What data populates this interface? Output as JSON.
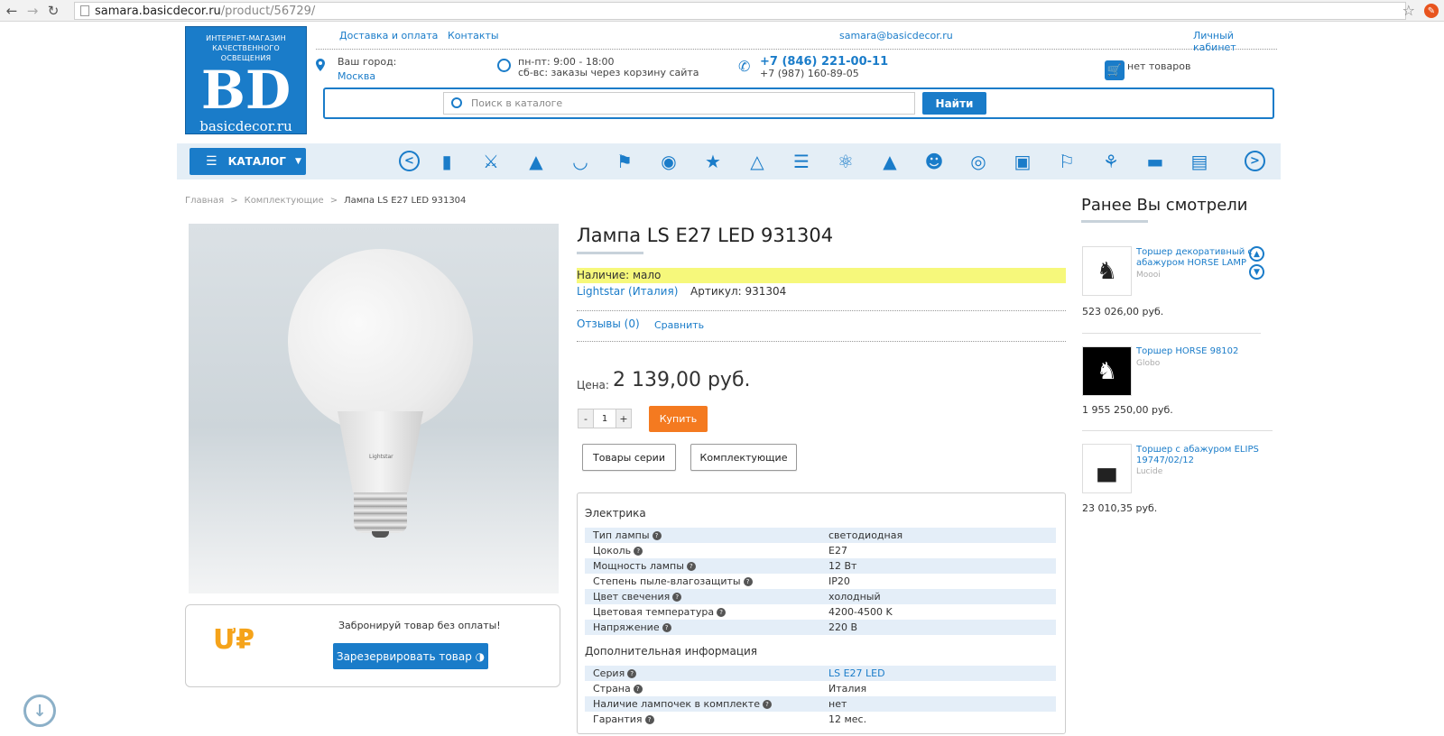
{
  "browser": {
    "url_host": "samara.basicdecor.ru",
    "url_path": "/product/56729/"
  },
  "header": {
    "logo": {
      "tagline_line1": "ИНТЕРНЕТ-МАГАЗИН",
      "tagline_line2": "КАЧЕСТВЕННОГО ОСВЕЩЕНИЯ",
      "mark": "BD",
      "site": "basicdecor.ru"
    },
    "links": {
      "delivery": "Доставка и оплата",
      "contacts": "Контакты",
      "email": "samara@basicdecor.ru",
      "account": "Личный кабинет"
    },
    "city": {
      "label": "Ваш город:",
      "value": "Москва"
    },
    "hours": {
      "line1": "пн-пт: 9:00 - 18:00",
      "line2": "сб-вс: заказы через корзину сайта"
    },
    "phones": {
      "main": "+7 (846) 221-00-11",
      "secondary": "+7 (987) 160-89-05"
    },
    "cart": "нет товаров",
    "search": {
      "placeholder": "Поиск в каталоге",
      "button": "Найти"
    }
  },
  "category_bar": {
    "catalog_button": "КАТАЛОГ",
    "icons": [
      "lamp-strip-icon",
      "chandelier-icon",
      "pendant-icon",
      "ceiling-bowl-icon",
      "wall-sconce-icon",
      "round-panel-icon",
      "spotlight-icon",
      "bell-pendant-icon",
      "track-light-icon",
      "desk-lamp-icon",
      "table-lamp-icon",
      "kids-lamp-icon",
      "bathroom-light-icon",
      "square-panel-icon",
      "street-lantern-icon",
      "floor-lamp-icon",
      "picture-light-icon",
      "led-strip-icon"
    ]
  },
  "breadcrumb": {
    "home": "Главная",
    "section": "Комплектующие",
    "current": "Лампа LS E27 LED 931304",
    "separator": ">"
  },
  "product": {
    "title": "Лампа LS E27 LED 931304",
    "availability": "Наличие: мало",
    "brand": "Lightstar (Италия)",
    "sku": "Артикул: 931304",
    "reviews": "Отзывы (0)",
    "compare": "Сравнить",
    "price_label": "Цена:",
    "price": "2 139,00 руб.",
    "qty": {
      "minus": "-",
      "value": "1",
      "plus": "+"
    },
    "buy": "Купить",
    "series_button": "Товары серии",
    "parts_button": "Комплектующие",
    "image_brand": "Lightstar",
    "reserve": {
      "text": "Забронируй товар без оплаты!",
      "button": "Зарезервировать товар",
      "icon": "Ư₽"
    },
    "specs": {
      "electrics_title": "Электрика",
      "electrics": [
        {
          "k": "Тип лампы",
          "v": "светодиодная"
        },
        {
          "k": "Цоколь",
          "v": "E27"
        },
        {
          "k": "Мощность лампы",
          "v": "12   Вт"
        },
        {
          "k": "Степень пыле-влагозащиты",
          "v": "IP20"
        },
        {
          "k": "Цвет свечения",
          "v": "холодный"
        },
        {
          "k": "Цветовая температура",
          "v": "4200-4500   K"
        },
        {
          "k": "Напряжение",
          "v": "220   В"
        }
      ],
      "extra_title": "Дополнительная информация",
      "extra": [
        {
          "k": "Серия",
          "v": "LS E27 LED"
        },
        {
          "k": "Страна",
          "v": "Италия"
        },
        {
          "k": "Наличие лампочек в комплекте",
          "v": "нет"
        },
        {
          "k": "Гарантия",
          "v": "12 мес."
        }
      ]
    }
  },
  "recently_viewed": {
    "title": "Ранее Вы смотрели",
    "items": [
      {
        "name": "Торшер декоративный с абажуром HORSE LAMP",
        "brand": "Moooi",
        "price": "523 026,00 руб."
      },
      {
        "name": "Торшер HORSE 98102",
        "brand": "Globo",
        "price": "1 955 250,00 руб."
      },
      {
        "name": "Торшер с абажуром ELIPS 19747/02/12",
        "brand": "Lucide",
        "price": "23 010,35 руб."
      }
    ]
  },
  "colors": {
    "accent": "#1a7cc9",
    "buy": "#f47a20",
    "availability_bg": "#f6f87b",
    "reserve_icon": "#f5a31a"
  }
}
